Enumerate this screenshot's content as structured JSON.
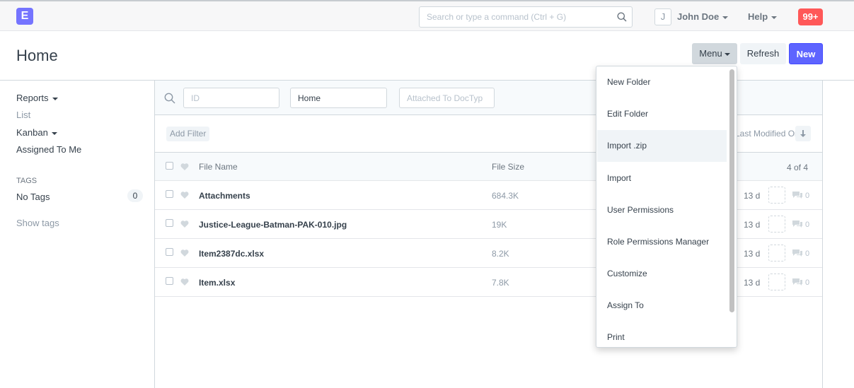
{
  "navbar": {
    "logo": "E",
    "search_placeholder": "Search or type a command (Ctrl + G)",
    "avatar": "J",
    "user_name": "John Doe",
    "help": "Help",
    "notifications": "99+"
  },
  "page": {
    "title": "Home",
    "menu_label": "Menu",
    "refresh_label": "Refresh",
    "new_label": "New"
  },
  "sidebar": {
    "reports": "Reports",
    "list": "List",
    "kanban": "Kanban",
    "assigned": "Assigned To Me",
    "tags_heading": "TAGS",
    "no_tags": "No Tags",
    "no_tags_count": "0",
    "show_tags": "Show tags"
  },
  "filters": {
    "id_placeholder": "ID",
    "folder_value": "Home",
    "attached_placeholder": "Attached To DocTyp",
    "add_filter": "Add Filter",
    "sort_label": "Last Modified On"
  },
  "list": {
    "col_file_name": "File Name",
    "col_file_size": "File Size",
    "count": "4 of 4",
    "rows": [
      {
        "name": "Attachments",
        "size": "684.3K",
        "modified": "13 d",
        "comments": "0"
      },
      {
        "name": "Justice-League-Batman-PAK-010.jpg",
        "size": "19K",
        "modified": "13 d",
        "comments": "0"
      },
      {
        "name": "Item2387dc.xlsx",
        "size": "8.2K",
        "modified": "13 d",
        "comments": "0"
      },
      {
        "name": "Item.xlsx",
        "size": "7.8K",
        "modified": "13 d",
        "comments": "0"
      }
    ]
  },
  "menu_items": [
    "New Folder",
    "Edit Folder",
    "Import .zip",
    "Import",
    "User Permissions",
    "Role Permissions Manager",
    "Customize",
    "Assign To",
    "Print"
  ],
  "colors": {
    "accent": "#5e64ff",
    "logo": "#7574ff",
    "badge": "#ff5858"
  }
}
